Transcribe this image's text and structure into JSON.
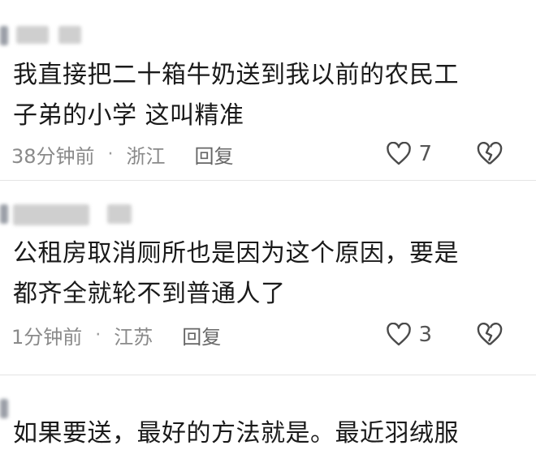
{
  "comments": [
    {
      "text_line1": "我直接把二十箱牛奶送到我以前的农民工",
      "text_line2": "子弟的小学  这叫精准",
      "time": "38分钟前",
      "location": "浙江",
      "reply_label": "回复",
      "like_count": "7"
    },
    {
      "text_line1": "公租房取消厕所也是因为这个原因，要是",
      "text_line2": "都齐全就轮不到普通人了",
      "time": "1分钟前",
      "location": "江苏",
      "reply_label": "回复",
      "like_count": "3"
    },
    {
      "text_line1": "如果要送，最好的方法就是。最近羽绒服"
    }
  ],
  "separator": "·",
  "icons": {
    "like": "heart-outline-icon",
    "dislike": "broken-heart-icon"
  },
  "colors": {
    "text": "#1a1a1a",
    "meta": "#8a8a8a",
    "icon": "#4a4a4a"
  }
}
